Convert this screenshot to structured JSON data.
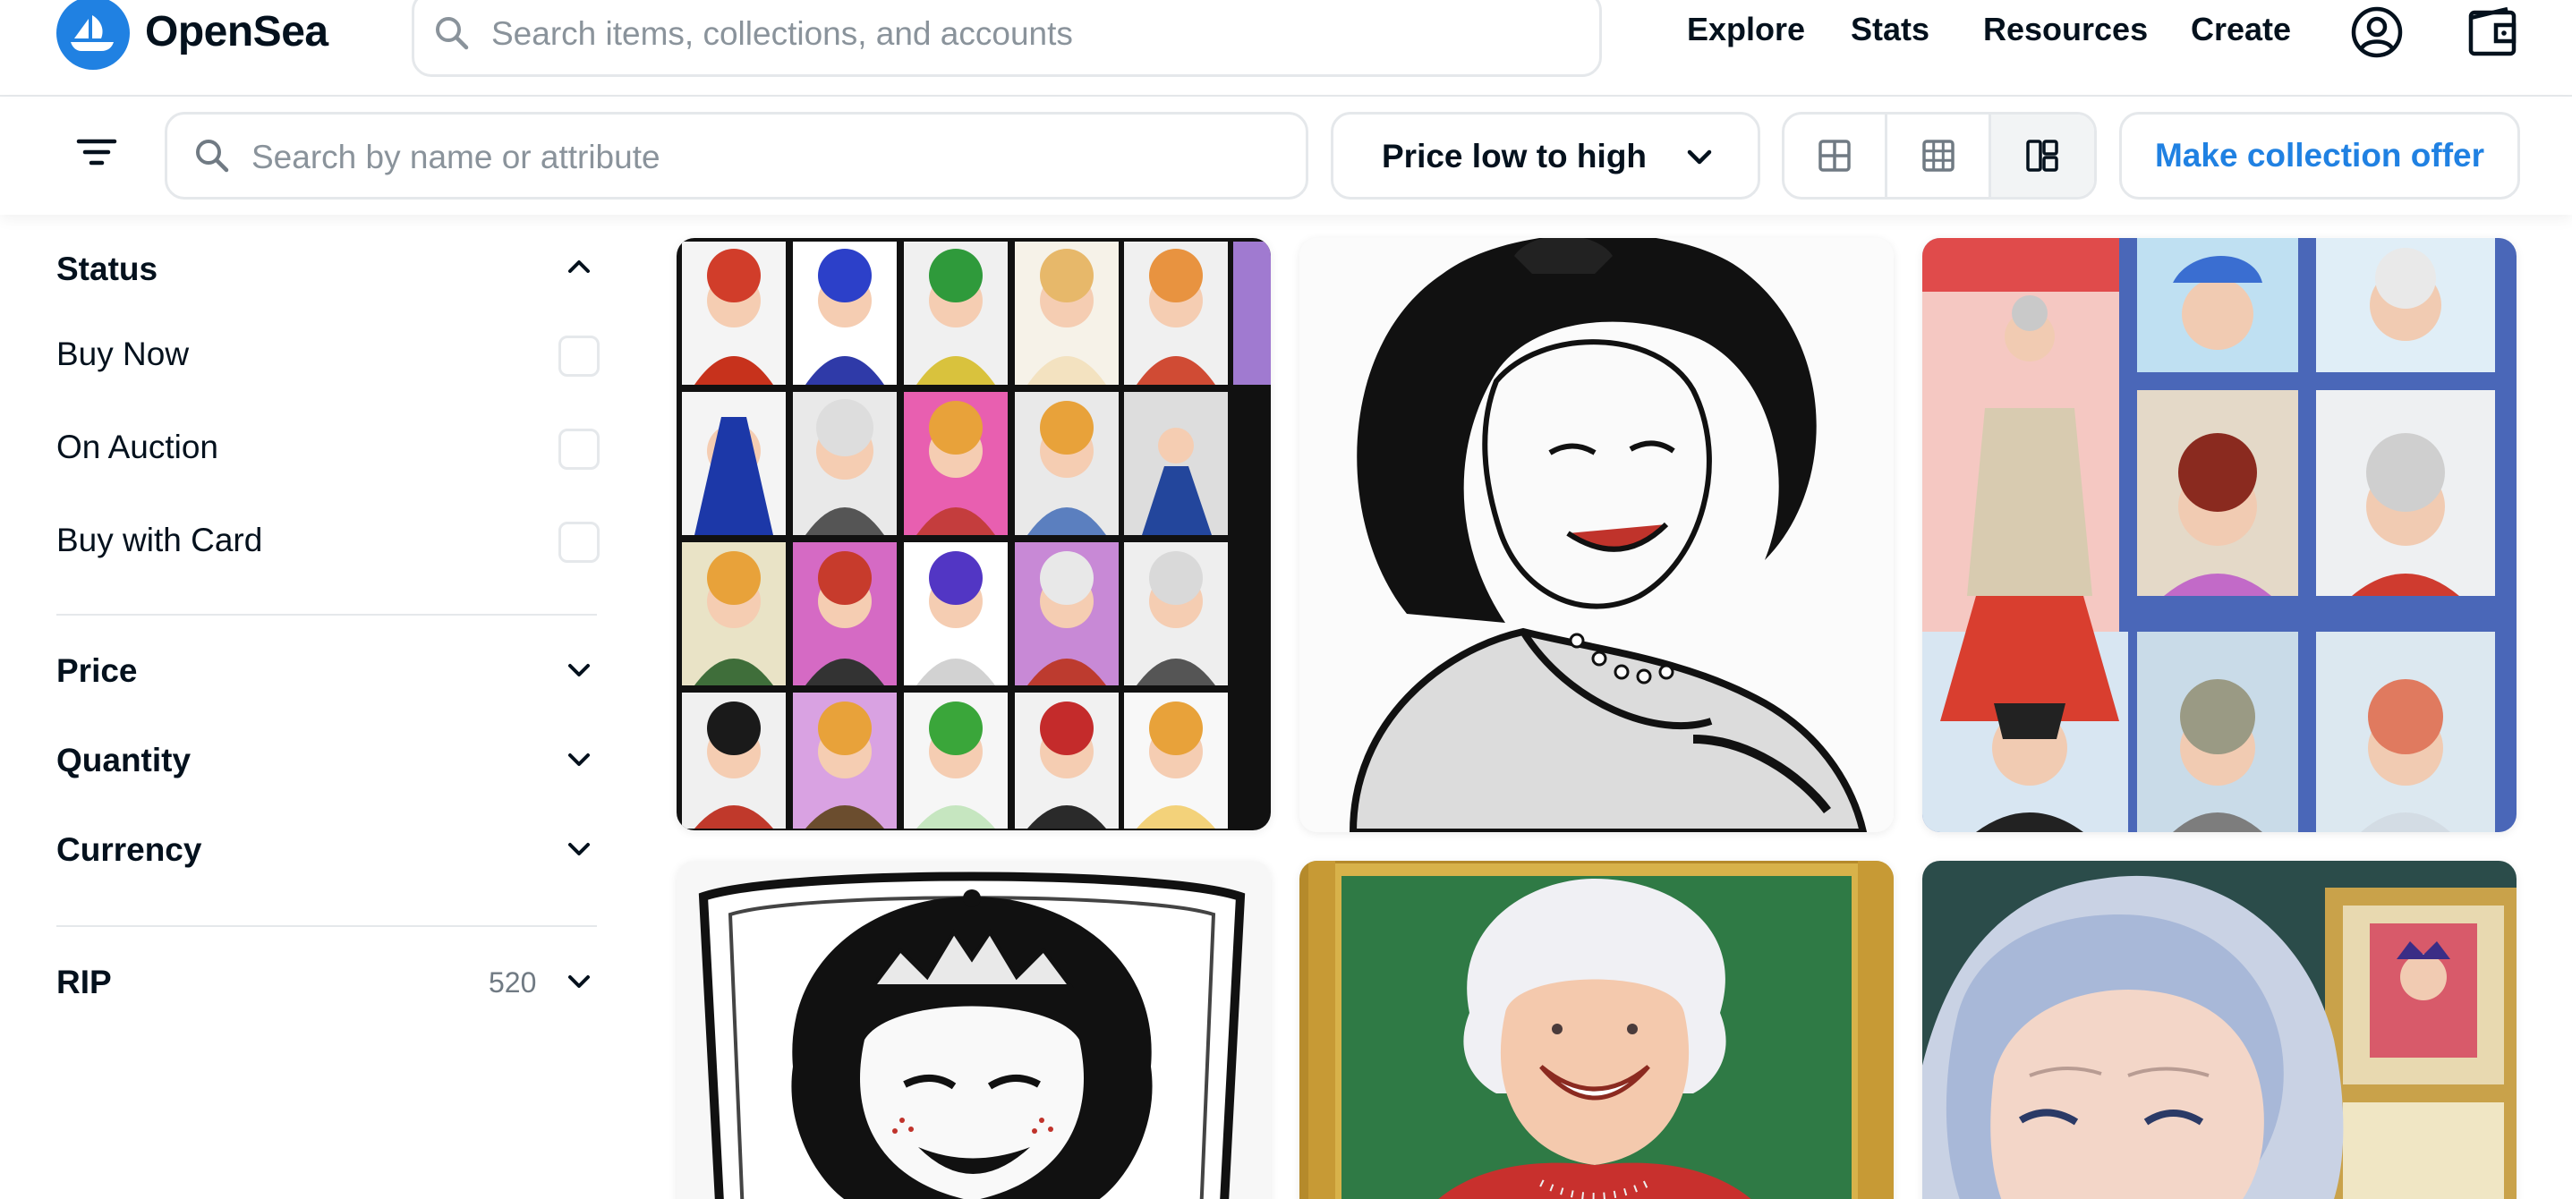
{
  "brand": {
    "name": "OpenSea",
    "accent": "#2081e2"
  },
  "top_search": {
    "placeholder": "Search items, collections, and accounts"
  },
  "nav": {
    "explore": "Explore",
    "stats": "Stats",
    "resources": "Resources",
    "create": "Create"
  },
  "filter_bar": {
    "search_placeholder": "Search by name or attribute",
    "sort_value": "Price low to high",
    "offer_button": "Make collection offer"
  },
  "sidebar": {
    "status": {
      "title": "Status",
      "options": [
        "Buy Now",
        "On Auction",
        "Buy with Card"
      ]
    },
    "price": "Price",
    "quantity": "Quantity",
    "currency": "Currency",
    "trait": {
      "name": "RIP",
      "count": "520"
    }
  },
  "icons": {
    "logo": "opensea-boat-icon",
    "search": "search-icon",
    "profile": "profile-icon",
    "wallet": "wallet-icon",
    "filter": "filter-icon",
    "chevron": "chevron-down-icon",
    "grid_large": "grid-large-icon",
    "grid_small": "grid-small-icon",
    "grid_masonry": "grid-masonry-icon"
  },
  "items": [
    "nft-card-1",
    "nft-card-2",
    "nft-card-3",
    "nft-card-4",
    "nft-card-5",
    "nft-card-6"
  ]
}
